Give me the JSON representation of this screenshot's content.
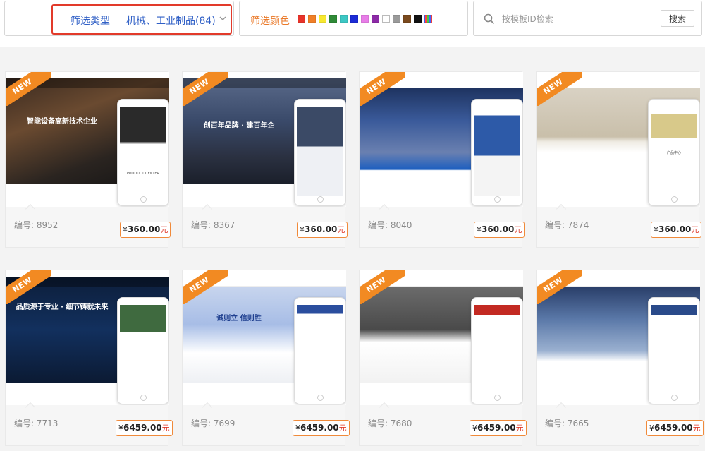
{
  "filter": {
    "type_label": "筛选类型",
    "type_value": "机械、工业制品(84)",
    "color_label": "筛选颜色",
    "colors": [
      "#e8332a",
      "#f07f28",
      "#f7e830",
      "#2f8a37",
      "#3cc7c4",
      "#1b2bd6",
      "#e87de8",
      "#8c2aa6",
      "#ffffff",
      "#9a9a9a",
      "#7a4a1e",
      "#111111",
      "multicolor"
    ],
    "search_placeholder": "按模板ID检索",
    "search_button": "搜索"
  },
  "badge_text": "NEW",
  "templates": [
    {
      "id_label": "编号: 8952",
      "currency": "¥",
      "price": "360.00",
      "unit": "元",
      "hero": "智能设备高新技术企业",
      "mobile_caption": "PRODUCT CENTER"
    },
    {
      "id_label": "编号: 8367",
      "currency": "¥",
      "price": "360.00",
      "unit": "元",
      "hero": "创百年品牌 · 建百年企",
      "mobile_caption": ""
    },
    {
      "id_label": "编号: 8040",
      "currency": "¥",
      "price": "360.00",
      "unit": "元",
      "hero": "",
      "mobile_caption": ""
    },
    {
      "id_label": "编号: 7874",
      "currency": "¥",
      "price": "360.00",
      "unit": "元",
      "hero": "",
      "mobile_caption": "产品中心"
    },
    {
      "id_label": "编号: 7713",
      "currency": "¥",
      "price": "6459.00",
      "unit": "元",
      "hero": "品质源于专业 · 细节铸就未来",
      "mobile_caption": ""
    },
    {
      "id_label": "编号: 7699",
      "currency": "¥",
      "price": "6459.00",
      "unit": "元",
      "hero": "诚则立  信则胜",
      "mobile_caption": ""
    },
    {
      "id_label": "编号: 7680",
      "currency": "¥",
      "price": "6459.00",
      "unit": "元",
      "hero": "",
      "mobile_caption": ""
    },
    {
      "id_label": "编号: 7665",
      "currency": "¥",
      "price": "6459.00",
      "unit": "元",
      "hero": "",
      "mobile_caption": ""
    }
  ]
}
